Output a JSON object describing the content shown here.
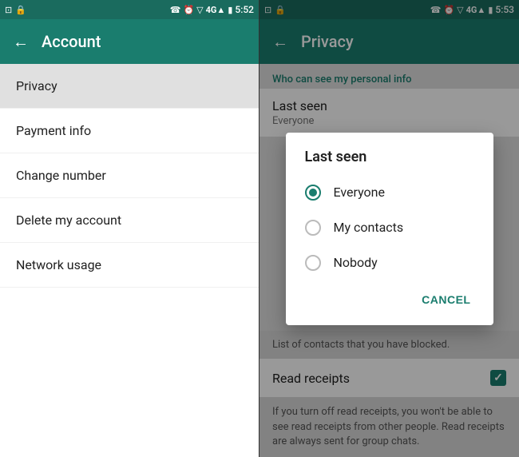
{
  "left": {
    "statusBar": {
      "time": "5:52",
      "icons": [
        "screenshot",
        "lock",
        "battery"
      ]
    },
    "appBar": {
      "title": "Account",
      "backLabel": "←"
    },
    "menuItems": [
      {
        "label": "Privacy",
        "highlighted": true
      },
      {
        "label": "Payment info"
      },
      {
        "label": "Change number"
      },
      {
        "label": "Delete my account"
      },
      {
        "label": "Network usage"
      }
    ]
  },
  "right": {
    "statusBar": {
      "time": "5:53"
    },
    "appBar": {
      "title": "Privacy",
      "backLabel": "←"
    },
    "sectionHeader": "Who can see my personal info",
    "lastSeenLabel": "Last seen",
    "lastSeenValue": "Everyone",
    "dialog": {
      "title": "Last seen",
      "options": [
        {
          "label": "Everyone",
          "selected": true
        },
        {
          "label": "My contacts",
          "selected": false
        },
        {
          "label": "Nobody",
          "selected": false
        }
      ],
      "cancelLabel": "CANCEL"
    },
    "blockedText": "List of contacts that you have blocked.",
    "readReceiptsLabel": "Read receipts",
    "readReceiptsChecked": true,
    "readReceiptsDesc": "If you turn off read receipts, you won't be able to see read receipts from other people. Read receipts are always sent for group chats."
  }
}
